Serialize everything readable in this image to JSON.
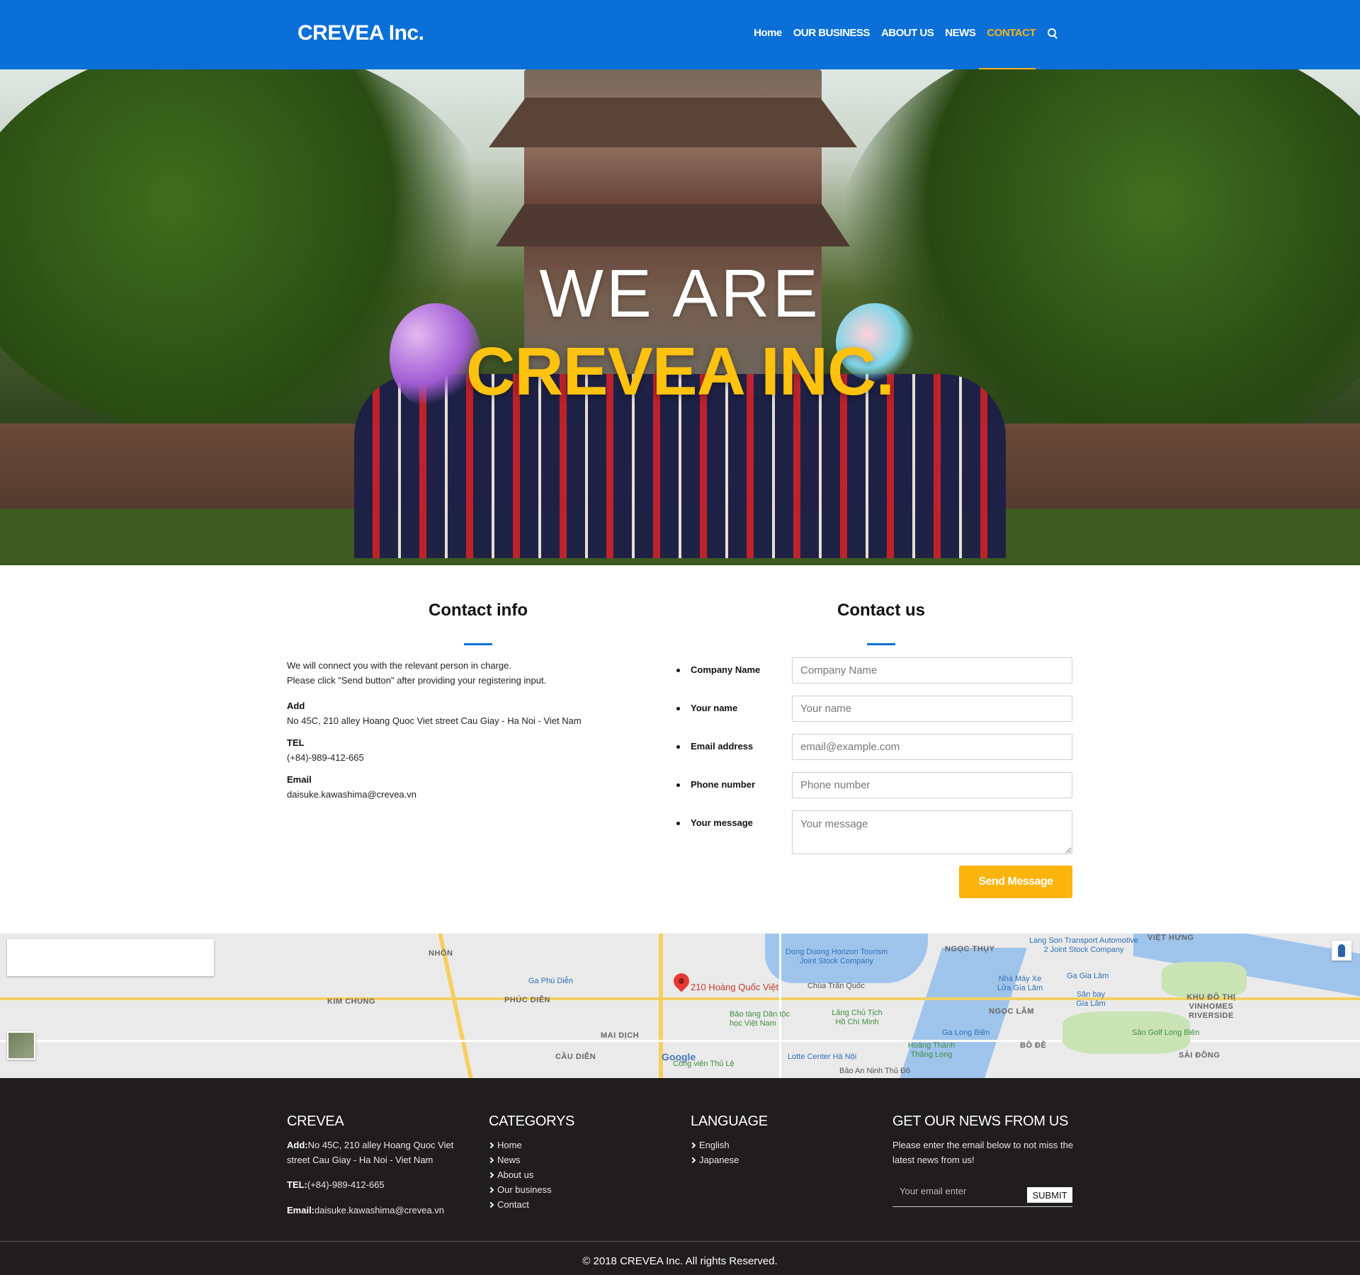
{
  "header": {
    "logo": "CREVEA Inc.",
    "nav": [
      {
        "label": "Home"
      },
      {
        "label": "OUR BUSINESS"
      },
      {
        "label": "ABOUT US"
      },
      {
        "label": "NEWS"
      },
      {
        "label": "CONTACT",
        "active": true
      }
    ],
    "accent_color": "#f2b21c",
    "bg_color": "#0a6fd6"
  },
  "hero": {
    "line1": "WE ARE",
    "line2": "CREVEA INC."
  },
  "contact_info": {
    "title": "Contact info",
    "intro_line1": "We will connect you with the relevant person in charge.",
    "intro_line2": "Please click \"Send button\" after providing your registering input.",
    "add_label": "Add",
    "add_value": "No 45C, 210 alley Hoang Quoc Viet street Cau Giay - Ha Noi - Viet Nam",
    "tel_label": "TEL",
    "tel_value": "(+84)-989-412-665",
    "email_label": "Email",
    "email_value": "daisuke.kawashima@crevea.vn"
  },
  "contact_form": {
    "title": "Contact us",
    "fields": [
      {
        "label": "Company Name",
        "placeholder": "Company Name"
      },
      {
        "label": "Your name",
        "placeholder": "Your name"
      },
      {
        "label": "Email address",
        "placeholder": "email@example.com"
      },
      {
        "label": "Phone number",
        "placeholder": "Phone number"
      },
      {
        "label": "Your message",
        "placeholder": "Your message"
      }
    ],
    "send_label": "Send Message",
    "button_color": "#fbb40c"
  },
  "map": {
    "pin_label": "210 Hoàng Quốc Việt",
    "labels": [
      "NHỔN",
      "KIM CHUNG",
      "PHÚC DIỄN",
      "Ga Phú Diễn",
      "MAI DỊCH",
      "CẦU DIỄN",
      "Bảo tàng Dân tộc học Việt Nam",
      "Công viên Thủ Lệ",
      "Lotte Center Hà Nội",
      "Dong Duong Horizon Tourism Joint Stock Company",
      "Chùa Trấn Quốc",
      "Lăng Chủ Tịch Hồ Chí Minh",
      "Hoàng Thành Thăng Long",
      "Bảo An Ninh Thủ Đô",
      "NGỌC THỤY",
      "NGỌC LÂM",
      "BỒ ĐỀ",
      "Ga Long Biên",
      "Nhà Máy Xe Lửa Gia Lâm",
      "Ga Gia Lâm",
      "Sân bay Gia Lâm",
      "Lang Son Transport Automotive 2 Joint Stock Company",
      "VIỆT HƯNG",
      "KHU ĐÔ THỊ VINHOMES RIVERSIDE",
      "Sân Golf Long Biên",
      "SÀI ĐỒNG",
      "Google"
    ]
  },
  "footer": {
    "col1": {
      "title": "CREVEA",
      "add_label": "Add:",
      "add_value": "No 45C, 210 alley Hoang Quoc Viet street Cau Giay - Ha Noi - Viet Nam",
      "tel_label": "TEL:",
      "tel_value": "(+84)-989-412-665",
      "email_label": "Email:",
      "email_value": "daisuke.kawashima@crevea.vn"
    },
    "col2": {
      "title": "CATEGORYS",
      "items": [
        "Home",
        "News",
        "About us",
        "Our business",
        "Contact"
      ]
    },
    "col3": {
      "title": "LANGUAGE",
      "items": [
        "English",
        "Japanese"
      ]
    },
    "col4": {
      "title": "GET OUR NEWS FROM US",
      "text": "Please enter the email below to not miss the latest news from us!",
      "placeholder": "Your email enter",
      "submit_label": "SUBMIT"
    },
    "copyright": "© 2018 CREVEA Inc. All rights Reserved."
  }
}
